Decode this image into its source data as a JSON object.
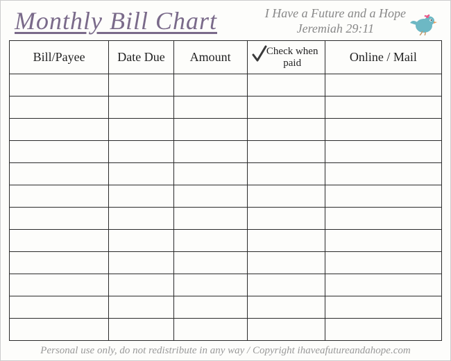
{
  "header": {
    "title": "Monthly Bill Chart",
    "scripture_line1": "I Have a Future and a Hope",
    "scripture_line2": "Jeremiah 29:11"
  },
  "columns": {
    "bill_payee": "Bill/Payee",
    "date_due": "Date Due",
    "amount": "Amount",
    "check_paid": "Check when paid",
    "online_mail": "Online / Mail"
  },
  "rows": [
    {
      "bill_payee": "",
      "date_due": "",
      "amount": "",
      "check_paid": "",
      "online_mail": ""
    },
    {
      "bill_payee": "",
      "date_due": "",
      "amount": "",
      "check_paid": "",
      "online_mail": ""
    },
    {
      "bill_payee": "",
      "date_due": "",
      "amount": "",
      "check_paid": "",
      "online_mail": ""
    },
    {
      "bill_payee": "",
      "date_due": "",
      "amount": "",
      "check_paid": "",
      "online_mail": ""
    },
    {
      "bill_payee": "",
      "date_due": "",
      "amount": "",
      "check_paid": "",
      "online_mail": ""
    },
    {
      "bill_payee": "",
      "date_due": "",
      "amount": "",
      "check_paid": "",
      "online_mail": ""
    },
    {
      "bill_payee": "",
      "date_due": "",
      "amount": "",
      "check_paid": "",
      "online_mail": ""
    },
    {
      "bill_payee": "",
      "date_due": "",
      "amount": "",
      "check_paid": "",
      "online_mail": ""
    },
    {
      "bill_payee": "",
      "date_due": "",
      "amount": "",
      "check_paid": "",
      "online_mail": ""
    },
    {
      "bill_payee": "",
      "date_due": "",
      "amount": "",
      "check_paid": "",
      "online_mail": ""
    },
    {
      "bill_payee": "",
      "date_due": "",
      "amount": "",
      "check_paid": "",
      "online_mail": ""
    },
    {
      "bill_payee": "",
      "date_due": "",
      "amount": "",
      "check_paid": "",
      "online_mail": ""
    }
  ],
  "footer": {
    "text": "Personal use only, do not redistribute in any way / Copyright ihaveafutureandahope.com"
  }
}
